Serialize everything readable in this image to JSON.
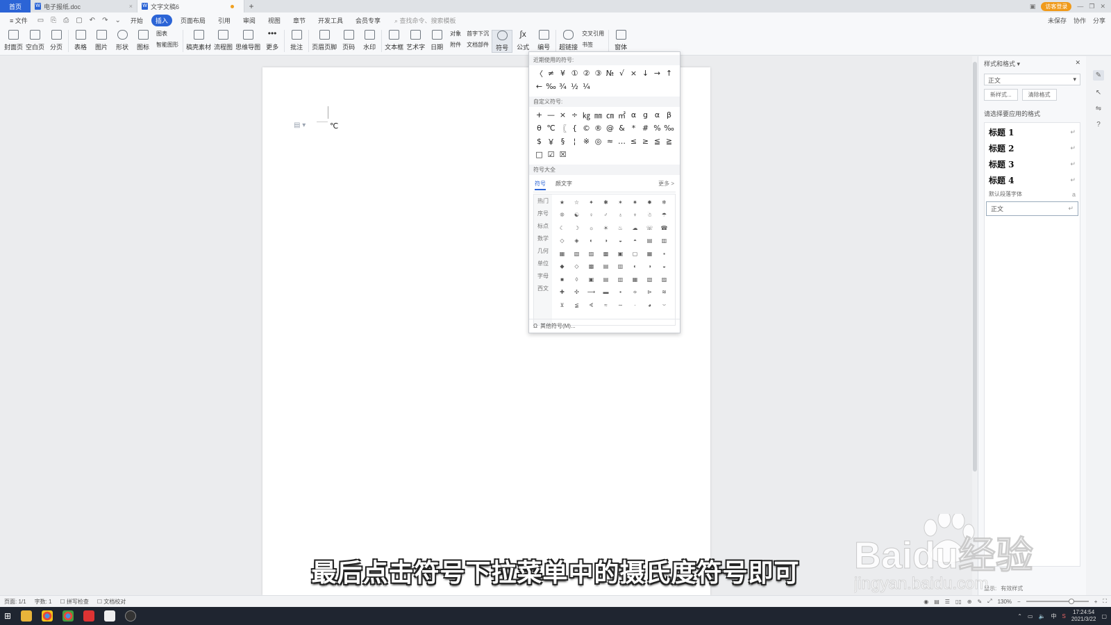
{
  "titlebar": {
    "home_tab": "首页",
    "tabs": [
      {
        "label": "电子报纸.doc",
        "active": false
      },
      {
        "label": "文字文稿6",
        "active": true
      }
    ],
    "new_tab": "+",
    "login_button": "访客登录"
  },
  "menubar": {
    "file": "≡ 文件",
    "tabs": [
      "开始",
      "插入",
      "页面布局",
      "引用",
      "审阅",
      "视图",
      "章节",
      "开发工具",
      "会员专享"
    ],
    "active_tab": "插入",
    "search_placeholder": "查找命令、搜索模板",
    "right_items": [
      "未保存",
      "协作",
      "分享"
    ]
  },
  "ribbon": {
    "buttons": [
      "封面页",
      "空白页",
      "分页",
      "表格",
      "图片",
      "形状",
      "图标",
      "稿壳素材",
      "流程图",
      "思维导图",
      "更多",
      "批注",
      "页眉页脚",
      "页码",
      "水印",
      "文本框",
      "艺术字",
      "日期",
      "符号",
      "公式",
      "编号",
      "超链接",
      "窗体"
    ],
    "small_groups": [
      [
        "图表",
        "智能图形"
      ],
      [
        "对象",
        "附件"
      ],
      [
        "首字下沉",
        "文档部件"
      ],
      [
        "交叉引用",
        "书签"
      ]
    ]
  },
  "document": {
    "inserted_symbol": "℃"
  },
  "symbol_dropdown": {
    "recent_title": "近期使用的符号:",
    "recent": [
      "〈",
      "≠",
      "¥",
      "①",
      "②",
      "③",
      "№",
      "√",
      "×",
      "↓",
      "→",
      "↑",
      "←",
      "‰",
      "¾",
      "½",
      "¼"
    ],
    "custom_title": "自定义符号:",
    "custom": [
      "+",
      "—",
      "×",
      "÷",
      "㎏",
      "㎜",
      "㎝",
      "㎡",
      "α",
      "g",
      "α",
      "β",
      "θ",
      "℃",
      "〖",
      "{",
      "©",
      "®",
      "@",
      "&",
      "*",
      "#",
      "%",
      "‰",
      "$",
      "￥",
      "§",
      "¦",
      "※",
      "◎",
      "≈",
      "…",
      "≤",
      "≥",
      "≦",
      "≧",
      "□",
      "☑",
      "☒"
    ],
    "all_title": "符号大全",
    "tabs": [
      "符号",
      "颜文字"
    ],
    "more": "更多 >",
    "categories": [
      "热门",
      "序号",
      "标点",
      "数学",
      "几何",
      "单位",
      "字母",
      "西文"
    ],
    "grid": [
      "★",
      "☆",
      "✦",
      "✱",
      "✶",
      "✷",
      "✸",
      "❄",
      "❊",
      "☯",
      "♀",
      "♂",
      "♁",
      "♆",
      "☃",
      "☂",
      "☾",
      "☽",
      "☼",
      "☀",
      "♨",
      "☁",
      "☏",
      "☎",
      "◇",
      "◈",
      "◐",
      "◑",
      "◒",
      "◓",
      "▤",
      "▥",
      "▦",
      "▧",
      "▨",
      "▩",
      "▣",
      "▢",
      "▦",
      "▪",
      "◆",
      "◇",
      "▩",
      "▤",
      "▥",
      "◐",
      "◑",
      "◒",
      "■",
      "◊",
      "▣",
      "▤",
      "▥",
      "▦",
      "▧",
      "▨",
      "✚",
      "✣",
      "⟶",
      "▬",
      "▪",
      "∻",
      "⊳",
      "≋",
      "⊻",
      "≨",
      "∢",
      "≈",
      "∼",
      "·",
      "◕",
      "⌣"
    ],
    "footer": "其他符号(M)..."
  },
  "style_panel": {
    "title": "样式和格式 ▾",
    "current_style": "正文",
    "new_style": "新样式...",
    "clear_format": "清除格式",
    "choose_label": "请选择要应用的格式",
    "styles": [
      "标题 1",
      "标题 2",
      "标题 3",
      "标题 4"
    ],
    "default_font": "默认段落字体",
    "body_style": "正文",
    "show_label": "显示:",
    "show_value": "有效样式"
  },
  "subtitle": "最后点击符号下拉菜单中的摄氏度符号即可",
  "watermark": {
    "brand": "Baidu经验",
    "url": "jingyan.baidu.com"
  },
  "statusbar": {
    "page": "页面: 1/1",
    "words": "字数: 1",
    "spellcheck": "拼写检查",
    "proofread": "文档校对",
    "zoom": "130%",
    "zoom_fraction": 0.75
  },
  "taskbar": {
    "time": "17:24:54",
    "date": "2021/3/22"
  },
  "colors": {
    "accent": "#2b64d6",
    "login": "#f09a1a"
  }
}
